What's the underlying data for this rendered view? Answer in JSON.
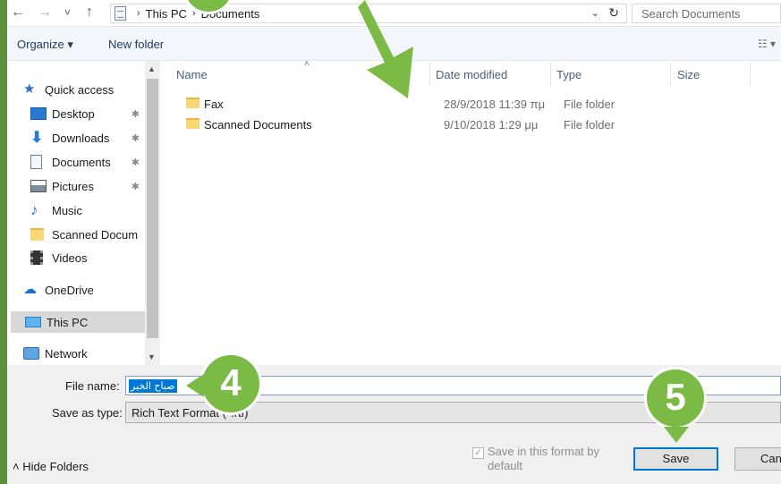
{
  "address_bar": {
    "nav_back": "←",
    "nav_forward": "→",
    "nav_recent": "˅",
    "nav_up": "↑",
    "crumb_this_pc": "This PC",
    "crumb_documents": "Documents",
    "search_placeholder": "Search Documents"
  },
  "toolbar": {
    "organize_label": "Organize ▾",
    "new_folder_label": "New folder"
  },
  "nav_pane": {
    "items": [
      {
        "label": "Quick access",
        "icon": "star-icon"
      },
      {
        "label": "Desktop",
        "icon": "desktop-icon"
      },
      {
        "label": "Downloads",
        "icon": "download-icon"
      },
      {
        "label": "Documents",
        "icon": "documents-icon"
      },
      {
        "label": "Pictures",
        "icon": "pictures-icon"
      },
      {
        "label": "Music",
        "icon": "music-icon"
      },
      {
        "label": "Scanned Docum",
        "icon": "folder-icon"
      },
      {
        "label": "Videos",
        "icon": "videos-icon"
      },
      {
        "label": "OneDrive",
        "icon": "cloud-icon"
      },
      {
        "label": "This PC",
        "icon": "computer-icon"
      },
      {
        "label": "Network",
        "icon": "network-icon"
      }
    ]
  },
  "file_list": {
    "columns": [
      "Name",
      "Date modified",
      "Type",
      "Size"
    ],
    "rows": [
      {
        "name": "Fax",
        "date": "28/9/2018 11:39 πμ",
        "type": "File folder",
        "size": ""
      },
      {
        "name": "Scanned Documents",
        "date": "9/10/2018 1:29 μμ",
        "type": "File folder",
        "size": ""
      }
    ]
  },
  "save_form": {
    "file_name_label": "File name:",
    "file_name_value": "صباح الخير",
    "save_type_label": "Save as type:",
    "save_type_value": "Rich Text Format (*.rtf)",
    "save_format_checkbox": "Save in this format by default",
    "save_button": "Save",
    "cancel_button": "Cancel",
    "hide_folders": "Hide Folders"
  },
  "annotations": {
    "step4": "4",
    "step5": "5"
  },
  "colors": {
    "annotation_green": "#7aba45",
    "frame_green": "#5e8f3a",
    "selection_blue": "#0078d7"
  }
}
